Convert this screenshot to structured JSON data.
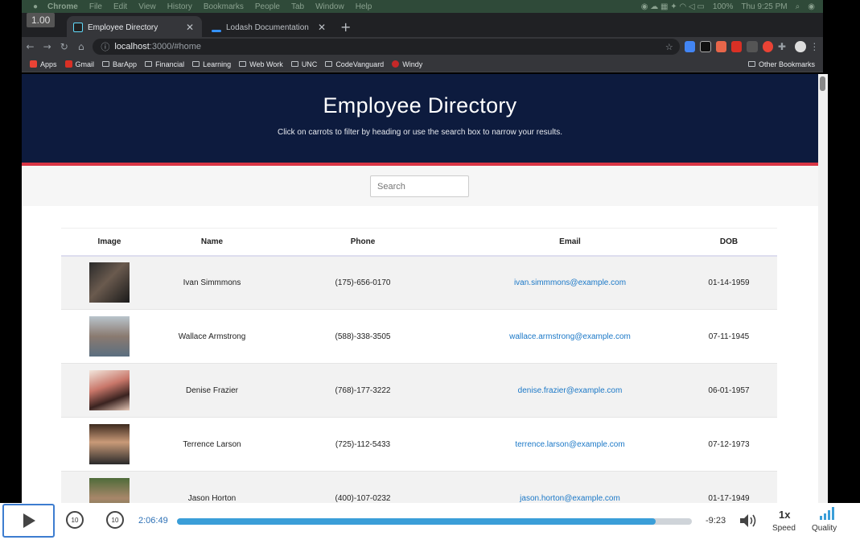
{
  "macos_menu": {
    "items": [
      "Chrome",
      "File",
      "Edit",
      "View",
      "History",
      "Bookmarks",
      "People",
      "Tab",
      "Window",
      "Help"
    ],
    "battery": "100%",
    "clock": "Thu 9:25 PM"
  },
  "overlay": {
    "version": "1.00"
  },
  "browser": {
    "tabs": [
      {
        "title": "Employee Directory",
        "active": true
      },
      {
        "title": "Lodash Documentation",
        "active": false
      }
    ],
    "url_host": "localhost",
    "url_rest": ":3000/#home",
    "bookmarks": [
      "Apps",
      "Gmail",
      "BarApp",
      "Financial",
      "Learning",
      "Web Work",
      "UNC",
      "CodeVanguard",
      "Windy"
    ],
    "other_bookmarks": "Other Bookmarks"
  },
  "page": {
    "title": "Employee Directory",
    "subtitle": "Click on carrots to filter by heading or use the search box to narrow your results.",
    "search_placeholder": "Search",
    "columns": [
      "Image",
      "Name",
      "Phone",
      "Email",
      "DOB"
    ],
    "employees": [
      {
        "name": "Ivan Simmmons",
        "phone": "(175)-656-0170",
        "email": "ivan.simmmons@example.com",
        "dob": "01-14-1959"
      },
      {
        "name": "Wallace Armstrong",
        "phone": "(588)-338-3505",
        "email": "wallace.armstrong@example.com",
        "dob": "07-11-1945"
      },
      {
        "name": "Denise Frazier",
        "phone": "(768)-177-3222",
        "email": "denise.frazier@example.com",
        "dob": "06-01-1957"
      },
      {
        "name": "Terrence Larson",
        "phone": "(725)-112-5433",
        "email": "terrence.larson@example.com",
        "dob": "07-12-1973"
      },
      {
        "name": "Jason Horton",
        "phone": "(400)-107-0232",
        "email": "jason.horton@example.com",
        "dob": "01-17-1949"
      }
    ]
  },
  "player": {
    "elapsed": "2:06:49",
    "remaining": "-9:23",
    "progress_fraction": 0.93,
    "skip_seconds": "10",
    "speed_value": "1x",
    "speed_label": "Speed",
    "quality_label": "Quality"
  },
  "colors": {
    "hero_bg": "#0d1b3e",
    "hero_rule": "#d93545",
    "link": "#1b78c7",
    "progress_fill": "#3a9ed8"
  }
}
